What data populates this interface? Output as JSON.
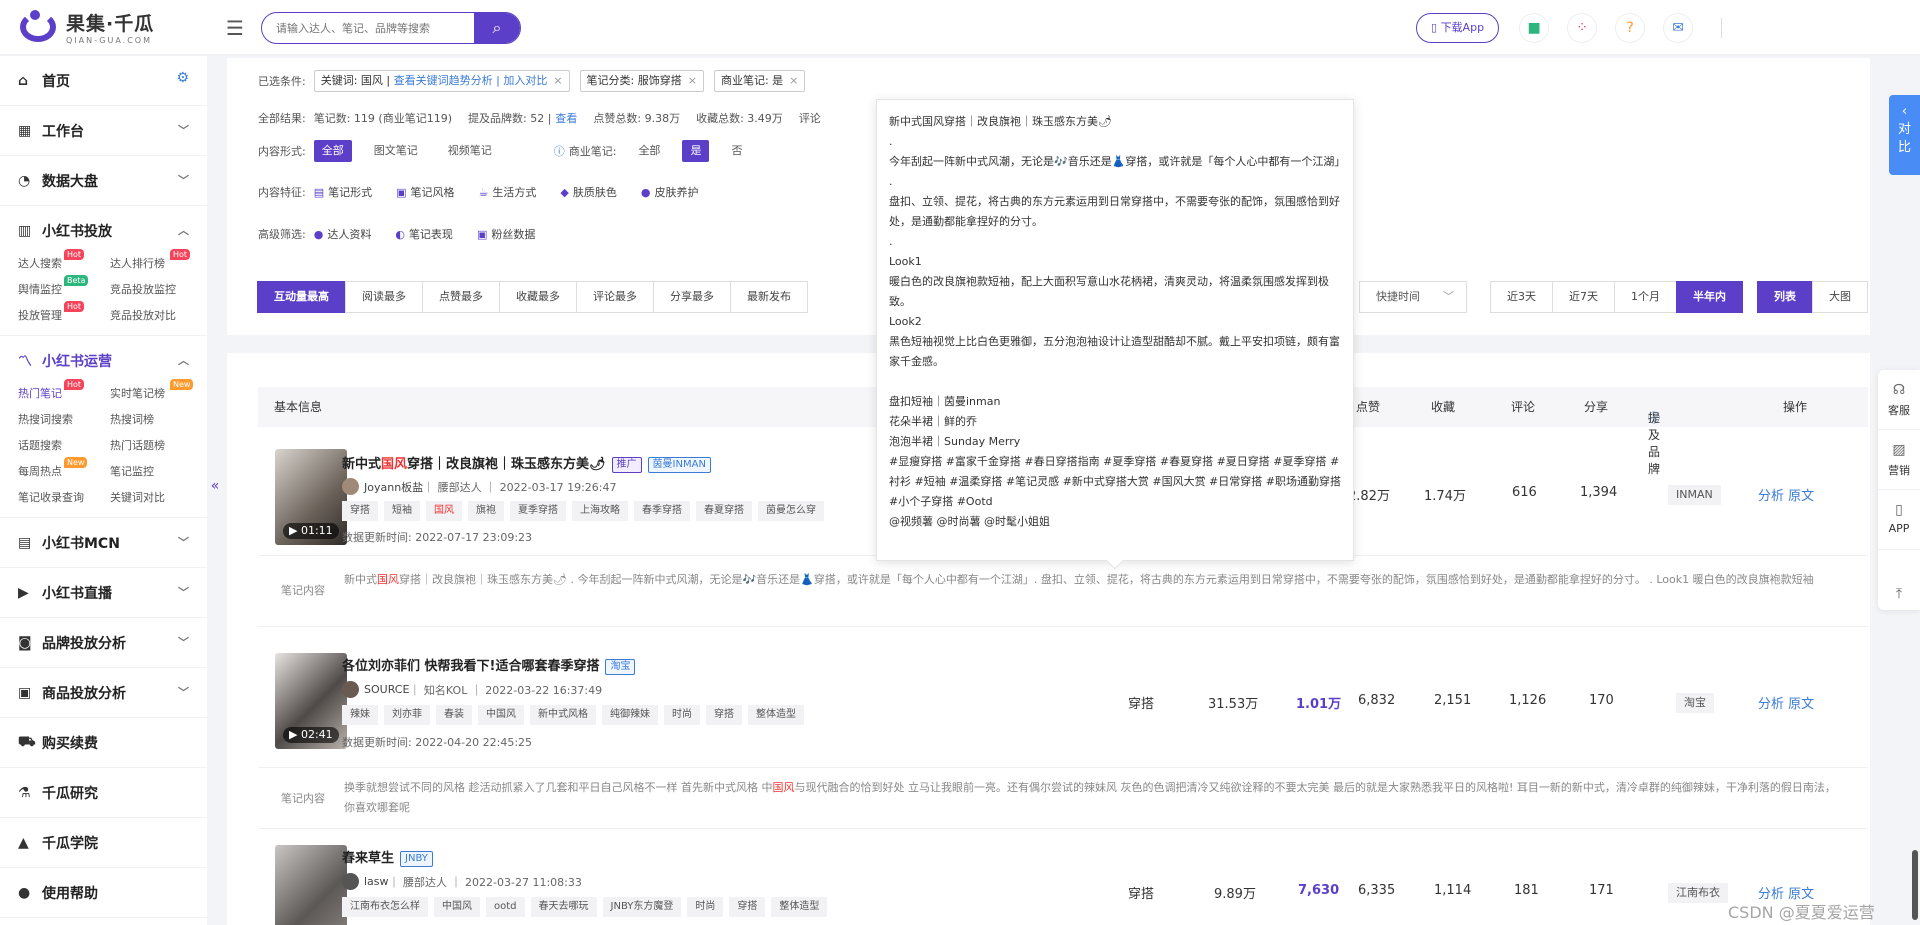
{
  "brand": {
    "name_cn": "果集·千瓜",
    "name_en": "QIAN-GUA.COM"
  },
  "search": {
    "placeholder": "请输入达人、笔记、品牌等搜索"
  },
  "top_right": {
    "download_app": "下载App"
  },
  "sidebar": {
    "home": "首页",
    "workbench": "工作台",
    "data_screen": "数据大盘",
    "xhs_delivery": {
      "title": "小红书投放",
      "items": [
        {
          "label": "达人搜索",
          "badge": "Hot"
        },
        {
          "label": "达人排行榜",
          "badge": "Hot"
        },
        {
          "label": "舆情监控",
          "badge": "Beta"
        },
        {
          "label": "竞品投放监控",
          "badge": ""
        },
        {
          "label": "投放管理",
          "badge": "Hot"
        },
        {
          "label": "竞品投放对比",
          "badge": ""
        }
      ]
    },
    "xhs_operation": {
      "title": "小红书运营",
      "items": [
        {
          "label": "热门笔记",
          "badge": "Hot"
        },
        {
          "label": "实时笔记榜",
          "badge": "New"
        },
        {
          "label": "热搜词搜索",
          "badge": ""
        },
        {
          "label": "热搜词榜",
          "badge": ""
        },
        {
          "label": "话题搜索",
          "badge": ""
        },
        {
          "label": "热门话题榜",
          "badge": ""
        },
        {
          "label": "每周热点",
          "badge": "New"
        },
        {
          "label": "笔记监控",
          "badge": ""
        },
        {
          "label": "笔记收录查询",
          "badge": ""
        },
        {
          "label": "关键词对比",
          "badge": ""
        }
      ]
    },
    "xhs_mcn": "小红书MCN",
    "xhs_live": "小红书直播",
    "brand_analysis": "品牌投放分析",
    "goods_analysis": "商品投放分析",
    "purchase": "购买续费",
    "research": "千瓜研究",
    "academy": "千瓜学院",
    "help": "使用帮助"
  },
  "filters": {
    "selected_label": "已选条件:",
    "chip_keyword_prefix": "关键词: 国风 | ",
    "chip_keyword_link1": "查看关键词趋势分析",
    "chip_keyword_sep": " | ",
    "chip_keyword_link2": "加入对比",
    "chip_category": "笔记分类: 服饰穿搭",
    "chip_commercial": "商业笔记: 是",
    "result_label": "全部结果:",
    "note_count": "笔记数: 119 (商业笔记119)",
    "brand_count": "提及品牌数: 52 |",
    "view_link": "查看",
    "likes_total": "点赞总数: 9.38万",
    "collect_total": "收藏总数: 3.49万",
    "review_cut": "评论",
    "content_form_label": "内容形式:",
    "content_forms": [
      "全部",
      "图文笔记",
      "视频笔记"
    ],
    "commercial_label": "商业笔记:",
    "commercial_opts": [
      "全部",
      "是",
      "否"
    ],
    "feature_label": "内容特征:",
    "features": [
      "笔记形式",
      "笔记风格",
      "生活方式",
      "肤质肤色",
      "皮肤养护"
    ],
    "advanced_label": "高级筛选:",
    "advanced": [
      "达人资料",
      "笔记表现",
      "粉丝数据"
    ],
    "sorts": [
      "互动量最高",
      "阅读最多",
      "点赞最多",
      "收藏最多",
      "评论最多",
      "分享最多",
      "最新发布"
    ],
    "quick_time": "快捷时间",
    "ranges": [
      "近3天",
      "近7天",
      "1个月",
      "半年内"
    ],
    "views": [
      "列表",
      "大图"
    ]
  },
  "list": {
    "headers": {
      "basic": "基本信息",
      "likes": "点赞",
      "collect": "收藏",
      "comments": "评论",
      "shares": "分享",
      "brand": "提及品牌",
      "ops": "操作"
    },
    "content_label": "笔记内容",
    "op_analyze": "分析",
    "op_origin": "原文",
    "rows": [
      {
        "title_pre": "新中式",
        "title_red": "国风",
        "title_post": "穿搭｜改良旗袍｜珠玉感东方美🌶",
        "tag1": "推广",
        "tag2": "茵曼INMAN",
        "author": "Joyann板盐",
        "author_meta": "｜ 腰部达人 ｜ 2022-03-17 19:26:47",
        "tags": [
          "穿搭",
          "短袖",
          "国风",
          "旗袍",
          "夏季穿搭",
          "上海攻略",
          "春季穿搭",
          "春夏穿搭",
          "茵曼怎么穿"
        ],
        "updated": "数据更新时间: 2022-07-17 23:09:23",
        "duration": "01:11",
        "category": "",
        "read": "",
        "interact": "",
        "likes": "2.82万",
        "collect": "1.74万",
        "comments": "616",
        "shares": "1,394",
        "brand": "INMAN",
        "content_pre": "新中式",
        "content_red": "国风",
        "content_post": "穿搭｜改良旗袍｜珠玉感东方美🌶 . 今年刮起一阵新中式风潮，无论是🎶音乐还是👗穿搭，或许就是「每个人心中都有一个江湖」. 盘扣、立领、提花，将古典的东方元素运用到日常穿搭中，不需要夸张的配饰，氛围感恰到好处，是通勤都能拿捏好的分寸。 . Look1 暖白色的改良旗袍款短袖"
      },
      {
        "title_pre": "各位刘亦菲们 快帮我看下!适合哪套春季穿搭",
        "title_red": "",
        "title_post": "",
        "tag1": "",
        "tag2": "淘宝",
        "author": "SOURCE",
        "author_meta": "｜ 知名KOL ｜ 2022-03-22 16:37:49",
        "tags": [
          "辣妹",
          "刘亦菲",
          "春装",
          "中国风",
          "新中式风格",
          "纯御辣妹",
          "时尚",
          "穿搭",
          "整体造型"
        ],
        "updated": "数据更新时间: 2022-04-20 22:45:25",
        "duration": "02:41",
        "category": "穿搭",
        "read": "31.53万",
        "interact": "1.01万",
        "likes": "6,832",
        "collect": "2,151",
        "comments": "1,126",
        "shares": "170",
        "brand": "淘宝",
        "content_pre": "换季就想尝试不同的风格 趁活动抓紧入了几套和平日自己风格不一样 首先新中式风格 中",
        "content_red": "国风",
        "content_post": "与现代融合的恰到好处 立马让我眼前一亮。还有偶尔尝试的辣妹风 灰色的色调把清冷又纯欲诠释的不要太完美 最后的就是大家熟悉我平日的风格啦! 耳目一新的新中式，清冷卓群的纯御辣妹，干净利落的假日南法，你喜欢哪套呢"
      },
      {
        "title_pre": "春来草生",
        "title_red": "",
        "title_post": "",
        "tag1": "",
        "tag2": "JNBY",
        "author": "lasw",
        "author_meta": "｜ 腰部达人 ｜ 2022-03-27 11:08:33",
        "tags": [
          "江南布衣怎么样",
          "中国风",
          "ootd",
          "春天去哪玩",
          "JNBY东方魔登",
          "时尚",
          "穿搭",
          "整体造型"
        ],
        "updated": "",
        "duration": "",
        "category": "穿搭",
        "read": "9.89万",
        "interact": "7,630",
        "likes": "6,335",
        "collect": "1,114",
        "comments": "181",
        "shares": "171",
        "brand": "江南布衣",
        "content_pre": "",
        "content_red": "",
        "content_post": ""
      }
    ]
  },
  "tooltip": {
    "lines": [
      "新中式国风穿搭｜改良旗袍｜珠玉感东方美🌶",
      ".",
      "今年刮起一阵新中式风潮，无论是🎶音乐还是👗穿搭，或许就是「每个人心中都有一个江湖」",
      ".",
      "盘扣、立领、提花，将古典的东方元素运用到日常穿搭中，不需要夸张的配饰，氛围感恰到好处，是通勤都能拿捏好的分寸。",
      ".",
      "Look1",
      "暖白色的改良旗袍款短袖，配上大面积写意山水花柄裙，清爽灵动，将温柔氛围感发挥到极致。",
      "Look2",
      "黑色短袖视觉上比白色更雅御，五分泡泡袖设计让造型甜酷却不腻。戴上平安扣项链，颇有富家千金感。",
      "",
      "盘扣短袖｜茵曼inman",
      "花朵半裙｜鲜的乔",
      "泡泡半裙｜Sunday Merry",
      "#显瘦穿搭 #富家千金穿搭 #春日穿搭指南 #夏季穿搭 #春夏穿搭 #夏日穿搭 #夏季穿搭 #衬衫 #短袖 #温柔穿搭 #笔记灵感 #新中式穿搭大赏 #国风大赏 #日常穿搭 #职场通勤穿搭 #小个子穿搭 #Ootd",
      "@视频薯  @时尚薯  @时髦小姐姐"
    ]
  },
  "right_tools": {
    "compare": "对比",
    "service": "客服",
    "marketing": "营销",
    "app": "APP"
  },
  "watermark": "CSDN @夏夏爱运营"
}
